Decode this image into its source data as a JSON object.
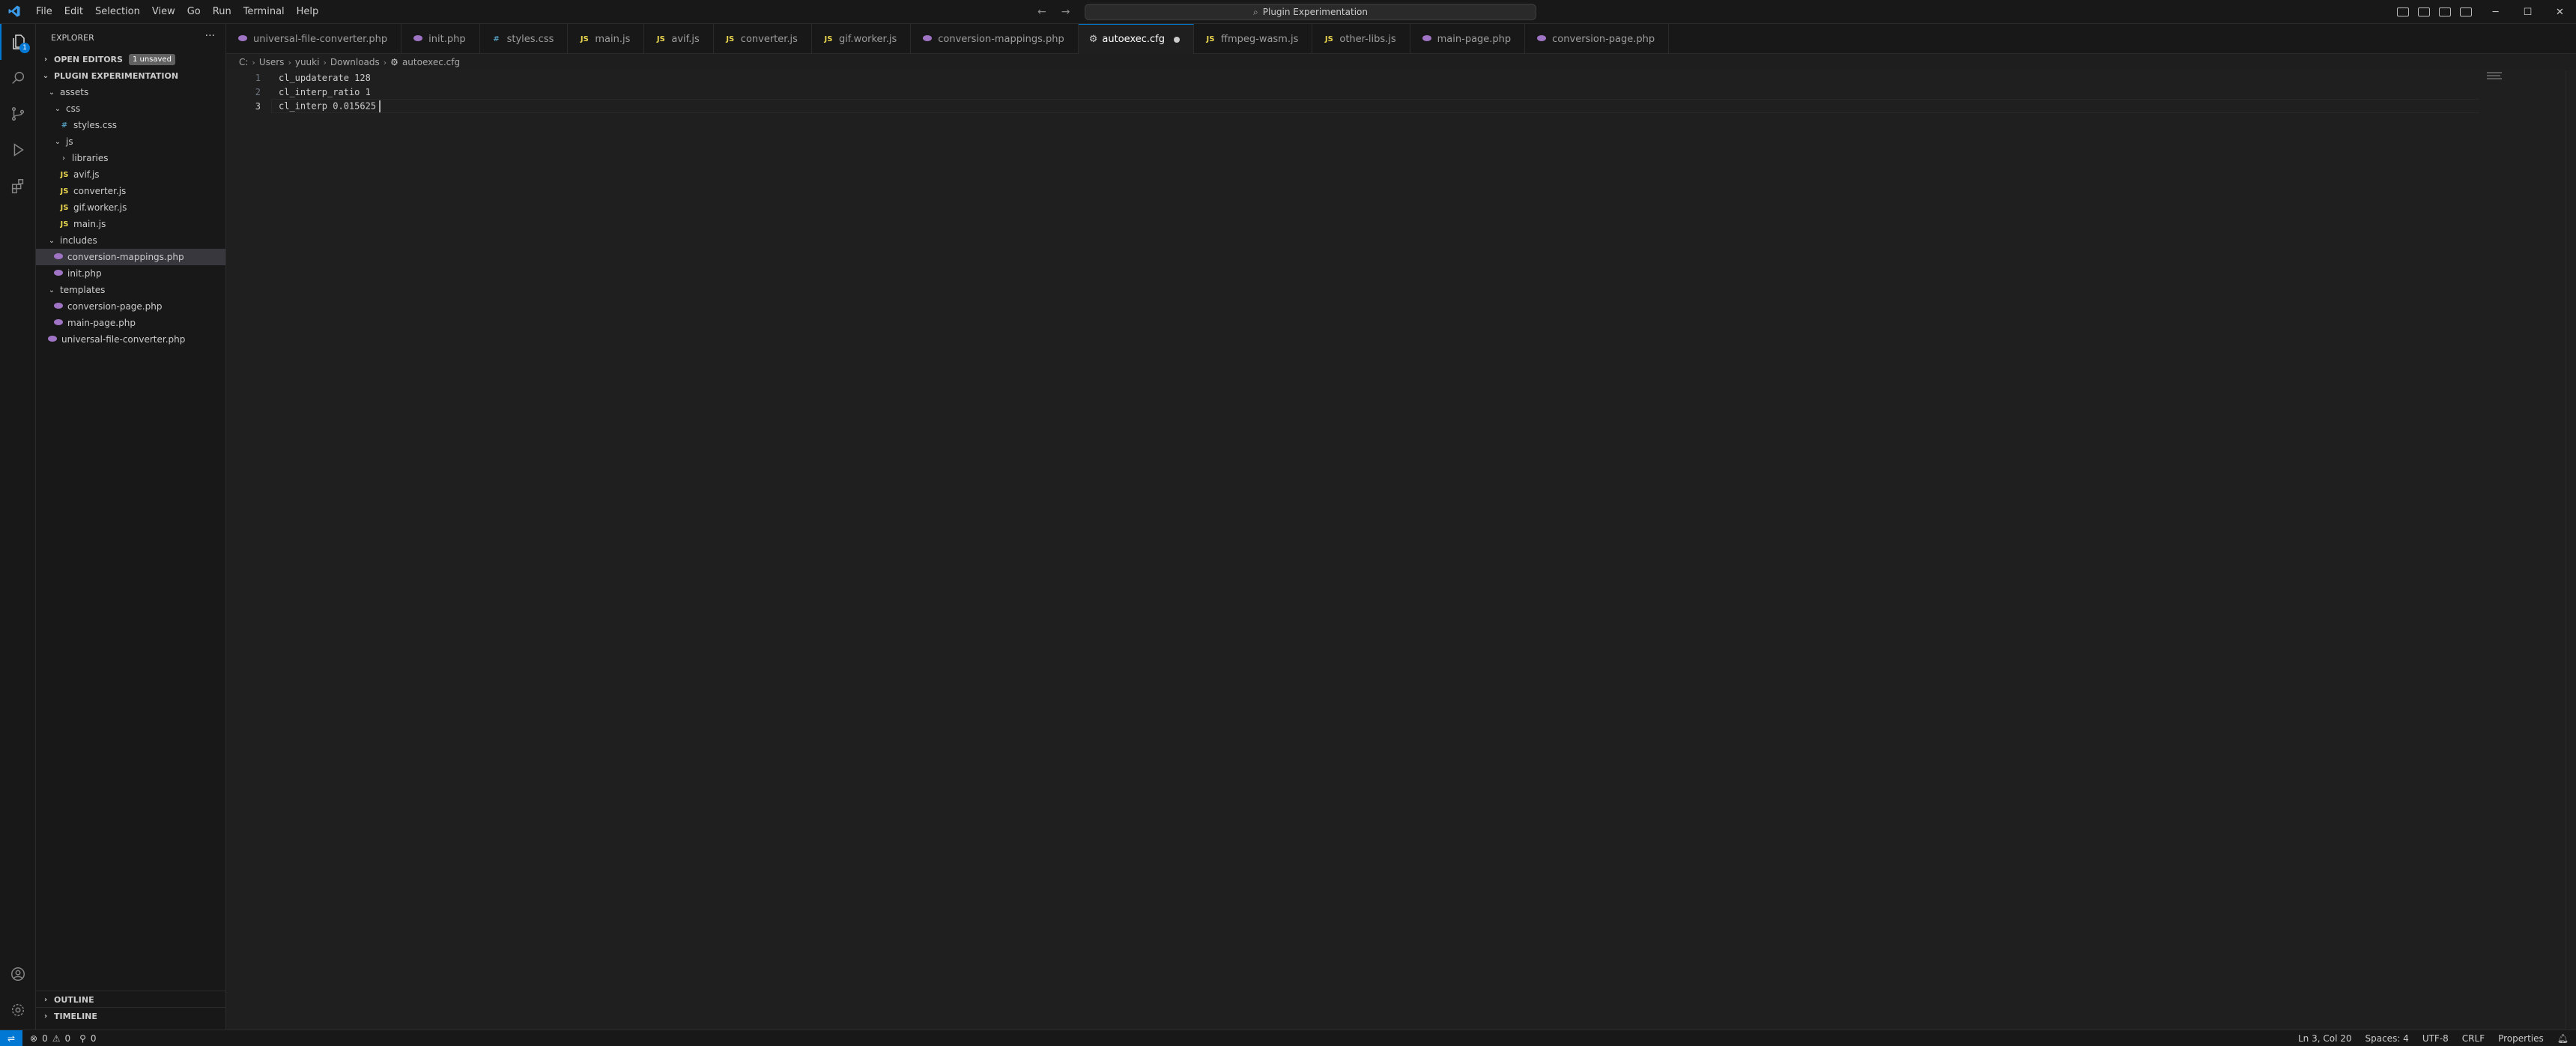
{
  "menu": [
    "File",
    "Edit",
    "Selection",
    "View",
    "Go",
    "Run",
    "Terminal",
    "Help"
  ],
  "command_center": {
    "label": "Plugin Experimentation",
    "icon": "search-icon"
  },
  "window_controls": [
    "─",
    "☐",
    "✕"
  ],
  "activity_bar": {
    "explorer_badge": "1"
  },
  "explorer": {
    "title": "EXPLORER",
    "open_editors": {
      "label": "OPEN EDITORS",
      "badge": "1 unsaved"
    },
    "project": {
      "label": "PLUGIN EXPERIMENTATION"
    },
    "tree": [
      {
        "label": "assets",
        "type": "folder",
        "depth": 0,
        "open": true
      },
      {
        "label": "css",
        "type": "folder",
        "depth": 1,
        "open": true
      },
      {
        "label": "styles.css",
        "type": "css",
        "depth": 2,
        "icon": "#"
      },
      {
        "label": "js",
        "type": "folder",
        "depth": 1,
        "open": true
      },
      {
        "label": "libraries",
        "type": "folder",
        "depth": 2,
        "open": false
      },
      {
        "label": "avif.js",
        "type": "js",
        "depth": 2,
        "icon": "JS"
      },
      {
        "label": "converter.js",
        "type": "js",
        "depth": 2,
        "icon": "JS"
      },
      {
        "label": "gif.worker.js",
        "type": "js",
        "depth": 2,
        "icon": "JS"
      },
      {
        "label": "main.js",
        "type": "js",
        "depth": 2,
        "icon": "JS"
      },
      {
        "label": "includes",
        "type": "folder",
        "depth": 0,
        "open": true
      },
      {
        "label": "conversion-mappings.php",
        "type": "php",
        "depth": 1,
        "selected": true
      },
      {
        "label": "init.php",
        "type": "php",
        "depth": 1
      },
      {
        "label": "templates",
        "type": "folder",
        "depth": 0,
        "open": true
      },
      {
        "label": "conversion-page.php",
        "type": "php",
        "depth": 1
      },
      {
        "label": "main-page.php",
        "type": "php",
        "depth": 1
      },
      {
        "label": "universal-file-converter.php",
        "type": "php",
        "depth": 0
      }
    ],
    "outline": "OUTLINE",
    "timeline": "TIMELINE"
  },
  "tabs": [
    {
      "label": "universal-file-converter.php",
      "type": "php"
    },
    {
      "label": "init.php",
      "type": "php"
    },
    {
      "label": "styles.css",
      "type": "css",
      "icon": "#"
    },
    {
      "label": "main.js",
      "type": "js",
      "icon": "JS"
    },
    {
      "label": "avif.js",
      "type": "js",
      "icon": "JS"
    },
    {
      "label": "converter.js",
      "type": "js",
      "icon": "JS"
    },
    {
      "label": "gif.worker.js",
      "type": "js",
      "icon": "JS"
    },
    {
      "label": "conversion-mappings.php",
      "type": "php"
    },
    {
      "label": "autoexec.cfg",
      "type": "cfg",
      "active": true,
      "dirty": true
    },
    {
      "label": "ffmpeg-wasm.js",
      "type": "js",
      "icon": "JS"
    },
    {
      "label": "other-libs.js",
      "type": "js",
      "icon": "JS"
    },
    {
      "label": "main-page.php",
      "type": "php"
    },
    {
      "label": "conversion-page.php",
      "type": "php"
    }
  ],
  "breadcrumb": [
    "C:",
    "Users",
    "yuuki",
    "Downloads",
    "autoexec.cfg"
  ],
  "editor": {
    "lines": [
      {
        "n": "1",
        "text": "cl_updaterate 128"
      },
      {
        "n": "2",
        "text": "cl_interp_ratio 1"
      },
      {
        "n": "3",
        "text": "cl_interp 0.015625"
      }
    ]
  },
  "status": {
    "errors": "0",
    "warnings": "0",
    "ports": "0",
    "position": "Ln 3, Col 20",
    "spaces": "Spaces: 4",
    "encoding": "UTF-8",
    "eol": "CRLF",
    "language": "Properties"
  }
}
